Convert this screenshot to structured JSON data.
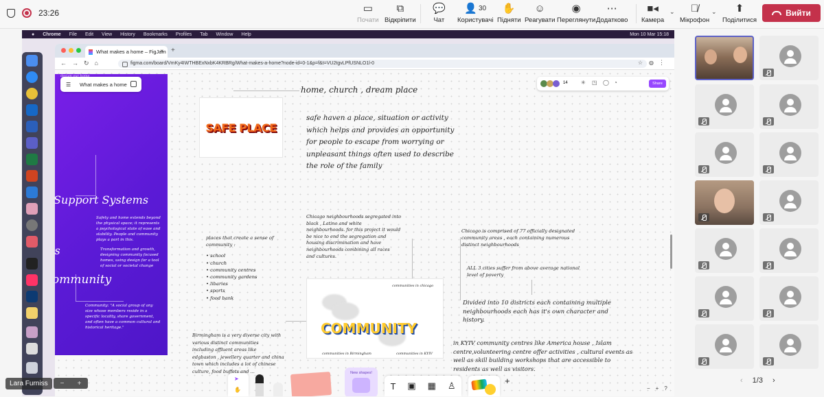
{
  "toolbar": {
    "time": "23:26",
    "buttons": [
      {
        "label": "Почати",
        "icon": "play-screen-icon",
        "disabled": true
      },
      {
        "label": "Відкріпити",
        "icon": "unpin-icon"
      },
      {
        "label": "Чат",
        "icon": "chat-icon"
      },
      {
        "label": "Користувачі",
        "icon": "people-icon",
        "badge": "30"
      },
      {
        "label": "Підняти",
        "icon": "raise-hand-icon"
      },
      {
        "label": "Реагувати",
        "icon": "react-icon"
      },
      {
        "label": "Переглянути",
        "icon": "view-icon"
      },
      {
        "label": "Додатково",
        "icon": "more-icon"
      },
      {
        "label": "Камера",
        "icon": "camera-icon"
      },
      {
        "label": "Мікрофон",
        "icon": "mic-off-icon"
      },
      {
        "label": "Поділитися",
        "icon": "share-icon"
      }
    ],
    "leave_label": "Вийти",
    "leave_color": "#c4314b"
  },
  "mac_menu": [
    "Chrome",
    "File",
    "Edit",
    "View",
    "History",
    "Bookmarks",
    "Profiles",
    "Tab",
    "Window",
    "Help"
  ],
  "mac_clock": "Mon 10 Mar 15:18",
  "browser": {
    "tab_title": "What makes a home – FigJam",
    "url": "figma.com/board/VmKy4IWTHBExNxbK4KRBRg/What-makes-a-home?node-id=0-1&p=f&t=VU2tgvLPfUSNLO1l-0"
  },
  "figjam": {
    "file_name": "What makes a home",
    "collab_count": "14",
    "share_label": "Share",
    "accent": "#9747ff",
    "purple_panel": {
      "top_label": "design our home",
      "heading1": "Support Systems",
      "heading2_fragment": "es",
      "heading3": "ommunity",
      "text1": "Safety and home extends beyond the physical space; it represents a psychological state of ease and stability. People and community plays a part in this.",
      "text2": "Transformation and growth, designing community focused homes, using design for a tool of social or societal change",
      "text3": "Community: \"A social group of any size whose members reside in a specific locality, share government, and often have a common cultural and historical heritage.\""
    },
    "notes": {
      "home_line": "home, church , dream place",
      "safe_image": "SAFE PLACE",
      "safe_def": [
        "safe haven a place, situation or activity",
        "which helps and provides an opportunity",
        "for people to escape from worrying or",
        "unpleasant things often used to describe",
        "the role of the family"
      ],
      "chicago_seg": [
        "Chicago neighbourhoods segregated into",
        "black , Latino and white",
        "neighbourhoods. for this project it would",
        "be nice to end the segregation and",
        "housing discrimination and have",
        "neighbourhoods combining all races",
        "and cultures."
      ],
      "places_title": [
        "places that create a sense of",
        "community :"
      ],
      "places_list": [
        "school",
        "church",
        "community centres",
        "community gardens",
        "libaries",
        "sports",
        "food bank"
      ],
      "chicago_77": [
        "Chicago is comprised of 77 officially designated",
        "community areas , each containing numerous",
        "distinct neighbourhoods"
      ],
      "poverty": [
        "ALL 3 cities suffer from above average national",
        "level of poverty"
      ],
      "districts": [
        "Divided into 10 districts each containing multiple",
        "neighbourhoods each has it's own character and",
        "history."
      ],
      "kyiv": [
        "in KYIV community centres like America house , Islam",
        "centre,volunteering centre offer activities , cultural events as",
        "well as skill building workshops that are accessible to",
        "residents as well as visitors."
      ],
      "birmingham": [
        "Birmingham is a very diverse city with",
        "various distinct communities",
        "including affluent areas like",
        "edgbaston , jewellery quarter and china",
        "town which includes a lot of chinese",
        "culture, food buffets and ..."
      ],
      "community_image": "COMMUNITY",
      "comm_chicago": "communities in chicago",
      "comm_birmingham": "communities in Birmingham",
      "comm_kyiv": "communities in KYIV"
    },
    "bottom_toolbar": {
      "new_shapes": "New shapes!",
      "text_tool": "T"
    }
  },
  "presenter_name": "Lara Furniss",
  "pager": "1/3"
}
